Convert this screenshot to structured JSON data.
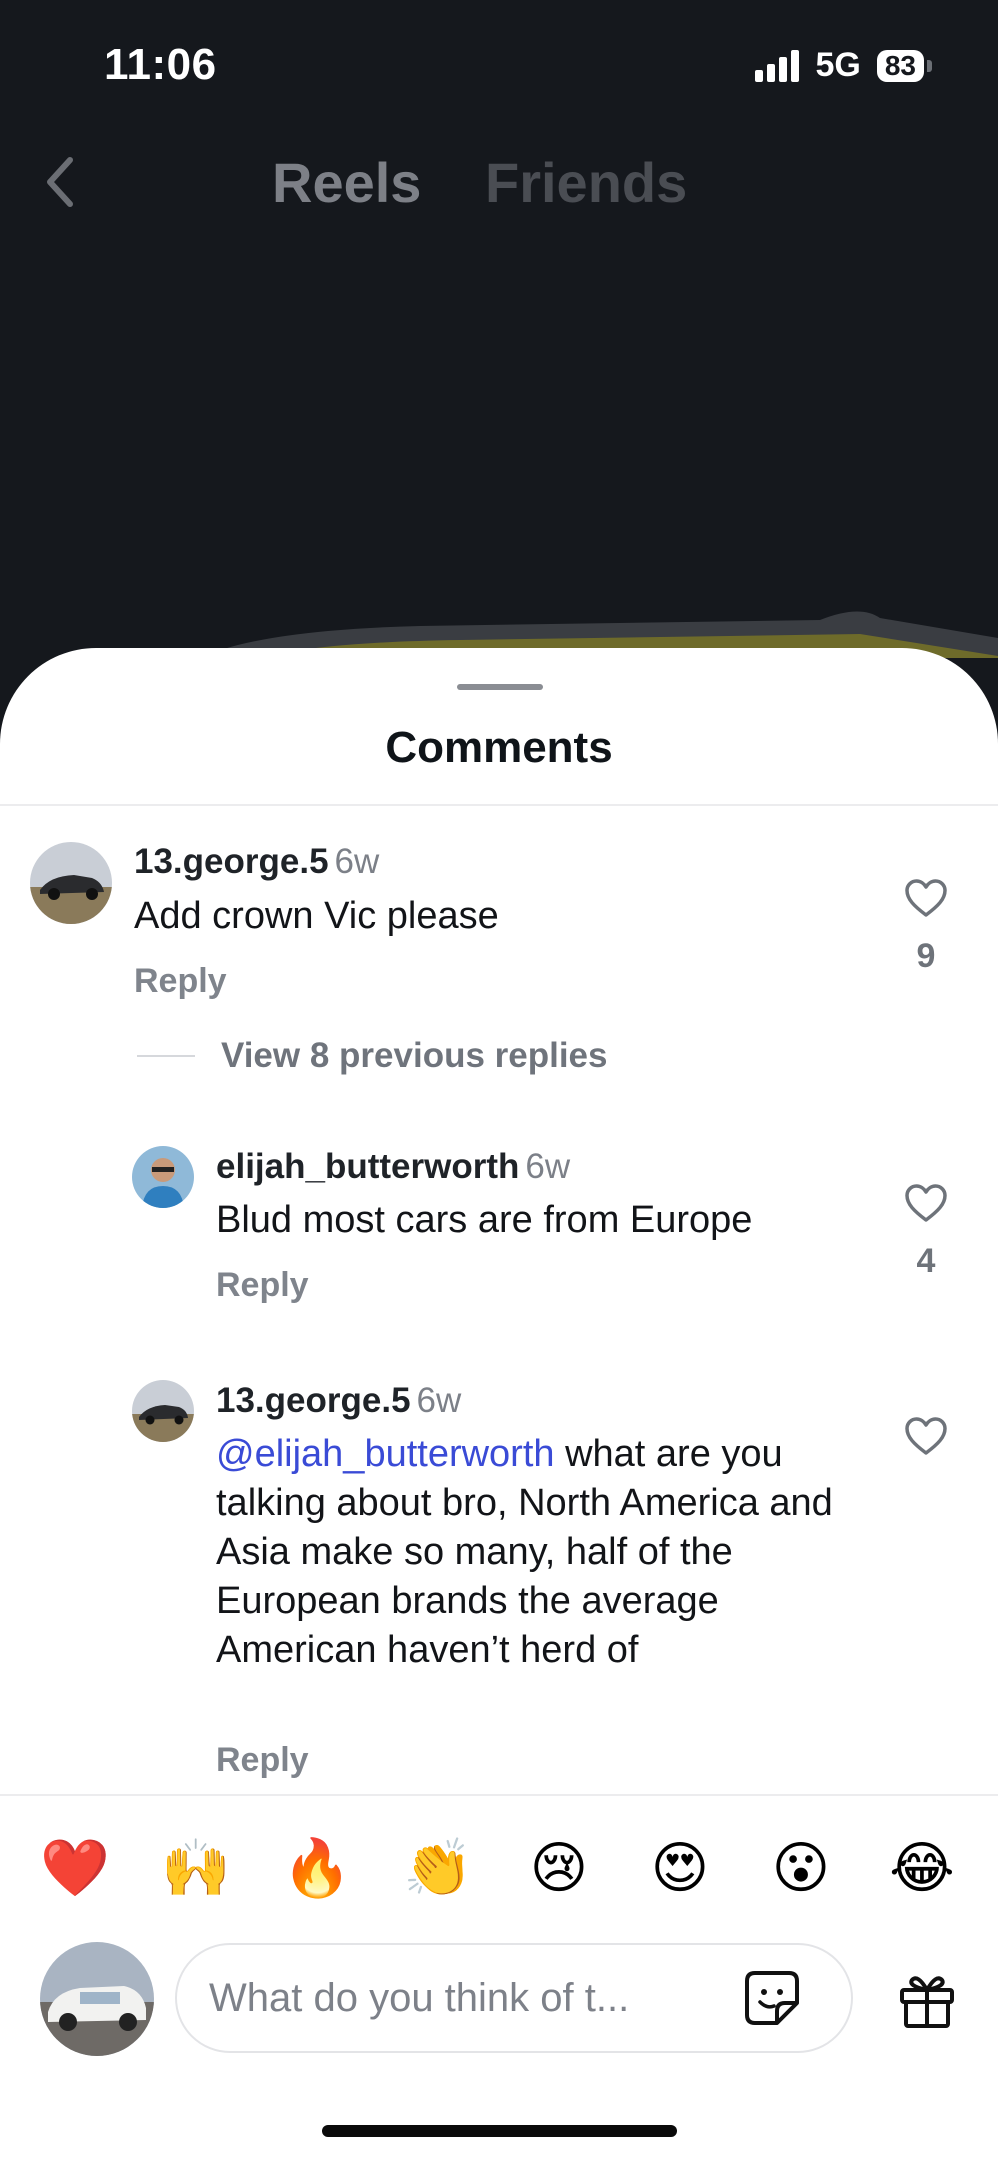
{
  "status_bar": {
    "time": "11:06",
    "network": "5G",
    "battery": "83"
  },
  "nav": {
    "tabs": [
      {
        "label": "Reels",
        "active": true
      },
      {
        "label": "Friends",
        "active": false
      }
    ]
  },
  "sheet": {
    "title": "Comments"
  },
  "comments": [
    {
      "username": "13.george.5",
      "time": "6w",
      "text": "Add crown Vic please",
      "reply_label": "Reply",
      "likes": "9"
    },
    {
      "username": "elijah_butterworth",
      "time": "6w",
      "text": "Blud most cars are from Europe",
      "reply_label": "Reply",
      "likes": "4"
    },
    {
      "username": "13.george.5",
      "time": "6w",
      "mention": "@elijah_butterworth",
      "text": " what are you talking about bro, North America and Asia make so many, half of the European brands the average American haven’t herd of",
      "reply_label": "Reply",
      "likes": ""
    }
  ],
  "view_replies": "View 8 previous replies",
  "emojis": [
    "❤️",
    "🙌",
    "🔥",
    "👏",
    "😢",
    "😍",
    "😮",
    "😂"
  ],
  "compose": {
    "placeholder": "What do you think of t..."
  },
  "colors": {
    "mention": "#3a4bd6",
    "sheet_bg": "#ffffff",
    "top_bg": "#15181d"
  }
}
